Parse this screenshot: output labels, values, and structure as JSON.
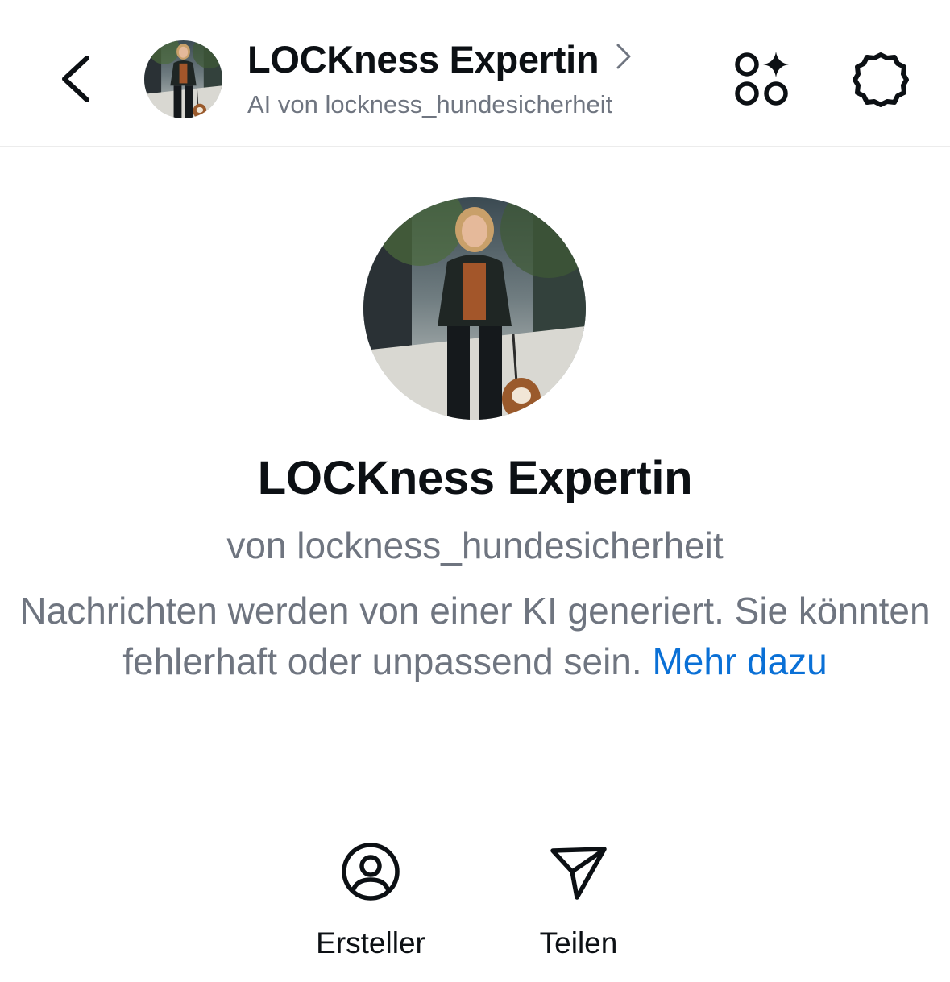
{
  "header": {
    "back_icon": "chevron-left-icon",
    "title": "LOCKness Expertin",
    "title_chevron_icon": "chevron-right-icon",
    "subtitle": "AI von lockness_hundesicherheit",
    "apps_icon": "shapes-sparkle-icon",
    "settings_icon": "gear-icon"
  },
  "profile": {
    "name": "LOCKness Expertin",
    "owner": "von lockness_hundesicherheit",
    "disclaimer": "Nachrichten werden von einer KI generiert. Sie könnten fehlerhaft oder unpassend sein.",
    "learn_more": "Mehr dazu"
  },
  "actions": [
    {
      "label": "Ersteller",
      "icon": "user-circle-icon"
    },
    {
      "label": "Teilen",
      "icon": "paper-plane-icon"
    }
  ],
  "colors": {
    "text_primary": "#0c1014",
    "text_secondary": "#6f7580",
    "link": "#0a70d6",
    "divider": "#ececec"
  }
}
